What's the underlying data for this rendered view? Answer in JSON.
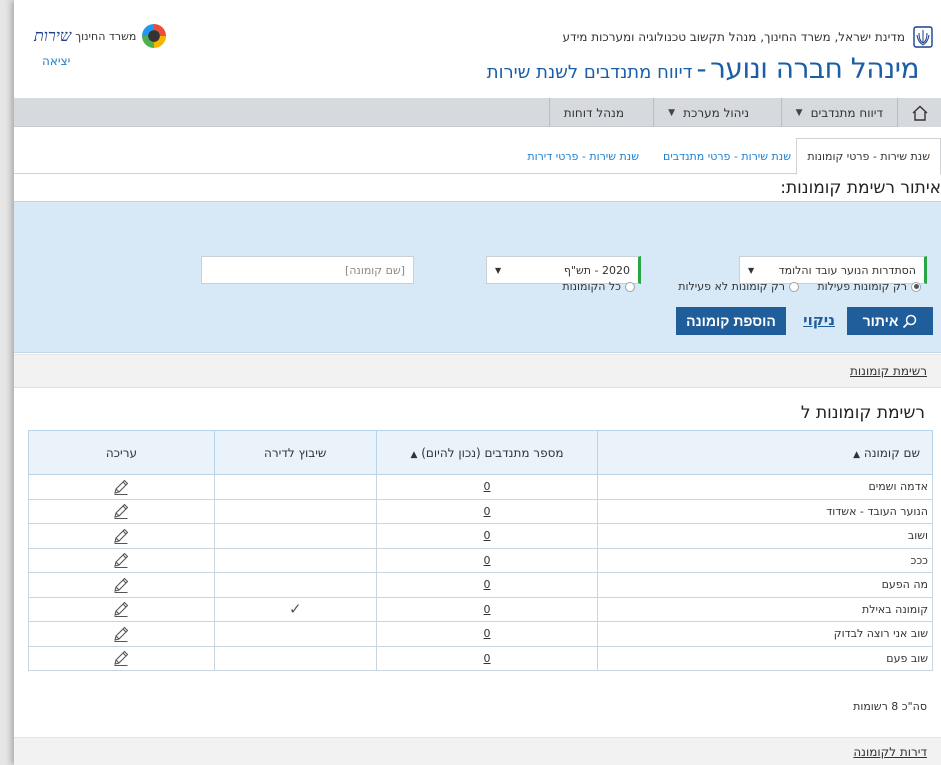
{
  "header": {
    "gov_line": "מדינת ישראל, משרד החינוך, מנהל תקשוב טכנולוגיה ומערכות מידע",
    "app_title_main": "מינהל חברה ונוער",
    "app_title_sep": "-",
    "app_title_sub": "דיווח מתנדבים לשנת שירות",
    "logo_text": "שירות",
    "ministry_text": "משרד החינוך",
    "logout": "יציאה"
  },
  "nav": {
    "items": [
      {
        "label": "דיווח מתנדבים",
        "has_dropdown": true
      },
      {
        "label": "ניהול מערכת",
        "has_dropdown": true
      },
      {
        "label": "מנהל דוחות",
        "has_dropdown": false
      }
    ]
  },
  "tabs": [
    {
      "label": "שנת שירות - פרטי קומונות",
      "active": true
    },
    {
      "label": "שנת שירות - פרטי מתנדבים",
      "active": false
    },
    {
      "label": "שנת שירות - פרטי דירות",
      "active": false
    }
  ],
  "filter": {
    "title": "איתור רשימת קומונות:",
    "organization_value": "הסתדרות הנוער עובד והלומד",
    "year_value": "2020 - תש\"ף",
    "name_placeholder": "[שם קומונה]",
    "radios": [
      {
        "label": "רק קומונות פעילות",
        "checked": true
      },
      {
        "label": "רק קומונות לא פעילות",
        "checked": false
      },
      {
        "label": "כל הקומונות",
        "checked": false
      }
    ],
    "search_button": "איתור",
    "clear_link": "ניקוי",
    "add_button": "הוספת קומונה"
  },
  "list_link": "רשימת קומונות",
  "list_title": "רשימת קומונות ל",
  "table": {
    "headers": {
      "name": "שם קומונה",
      "volunteers": "מספר מתנדבים (נכון להיום)",
      "apartment": "שיבוץ לדירה",
      "edit": "עריכה"
    },
    "rows": [
      {
        "name": "אדמה ושמים",
        "volunteers": "0",
        "apartment": ""
      },
      {
        "name": "הנוער העובד - אשדוד",
        "volunteers": "0",
        "apartment": ""
      },
      {
        "name": "ושוב",
        "volunteers": "0",
        "apartment": ""
      },
      {
        "name": "כככ",
        "volunteers": "0",
        "apartment": ""
      },
      {
        "name": "מה הפעם",
        "volunteers": "0",
        "apartment": ""
      },
      {
        "name": "קומונה באילת",
        "volunteers": "0",
        "apartment": "✓"
      },
      {
        "name": "שוב אני רוצה לבדוק",
        "volunteers": "0",
        "apartment": ""
      },
      {
        "name": "שוב פעם",
        "volunteers": "0",
        "apartment": ""
      }
    ]
  },
  "total_text": "סה\"כ 8 רשומות",
  "apartments_link": "דירות לקומונה",
  "colors": {
    "brand_blue": "#1b5ea8",
    "button_blue": "#1f5d9b",
    "filter_bg": "#d7e9f6",
    "select_accent": "#27a844",
    "link_blue": "#1b7fd0"
  }
}
